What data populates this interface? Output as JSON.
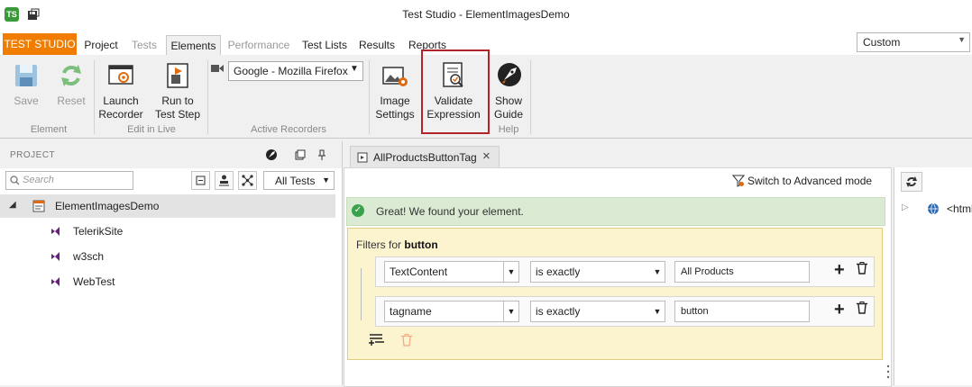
{
  "window": {
    "title": "Test Studio - ElementImagesDemo",
    "app_icon": "TS"
  },
  "tabs": {
    "brand": "TEST STUDIO",
    "items": [
      "Project",
      "Tests",
      "Elements",
      "Performance",
      "Test Lists",
      "Results",
      "Reports"
    ],
    "active": "Elements",
    "disabled": [
      "Tests",
      "Performance"
    ]
  },
  "layout_select": {
    "value": "Custom"
  },
  "ribbon": {
    "save": "Save",
    "reset": "Reset",
    "group_element": "Element",
    "launch_recorder": "Launch Recorder",
    "run_to_step": "Run to Test Step",
    "group_edit_live": "Edit in Live",
    "browser": "Google - Mozilla Firefox",
    "group_active_recorders": "Active Recorders",
    "image_settings": "Image Settings",
    "validate_expression": "Validate Expression",
    "show_guide": "Show Guide",
    "group_help": "Help"
  },
  "project": {
    "title": "PROJECT",
    "search_placeholder": "Search",
    "filter": "All Tests",
    "root": "ElementImagesDemo",
    "items": [
      "TelerikSite",
      "w3sch",
      "WebTest"
    ]
  },
  "editor": {
    "tab": "AllProductsButtonTag",
    "advanced_mode": "Switch to Advanced mode",
    "success": "Great! We found your element.",
    "filters_label": "Filters for",
    "filters_element": "button",
    "rows": [
      {
        "attribute": "TextContent",
        "operator": "is exactly",
        "value": "All Products"
      },
      {
        "attribute": "tagname",
        "operator": "is exactly",
        "value": "button"
      }
    ]
  },
  "dom_panel": {
    "node": "<html"
  },
  "colors": {
    "brand": "#f07d00",
    "highlight": "#b0242a",
    "success_bg": "#dbebd3",
    "filters_bg": "#fcf3cf"
  }
}
